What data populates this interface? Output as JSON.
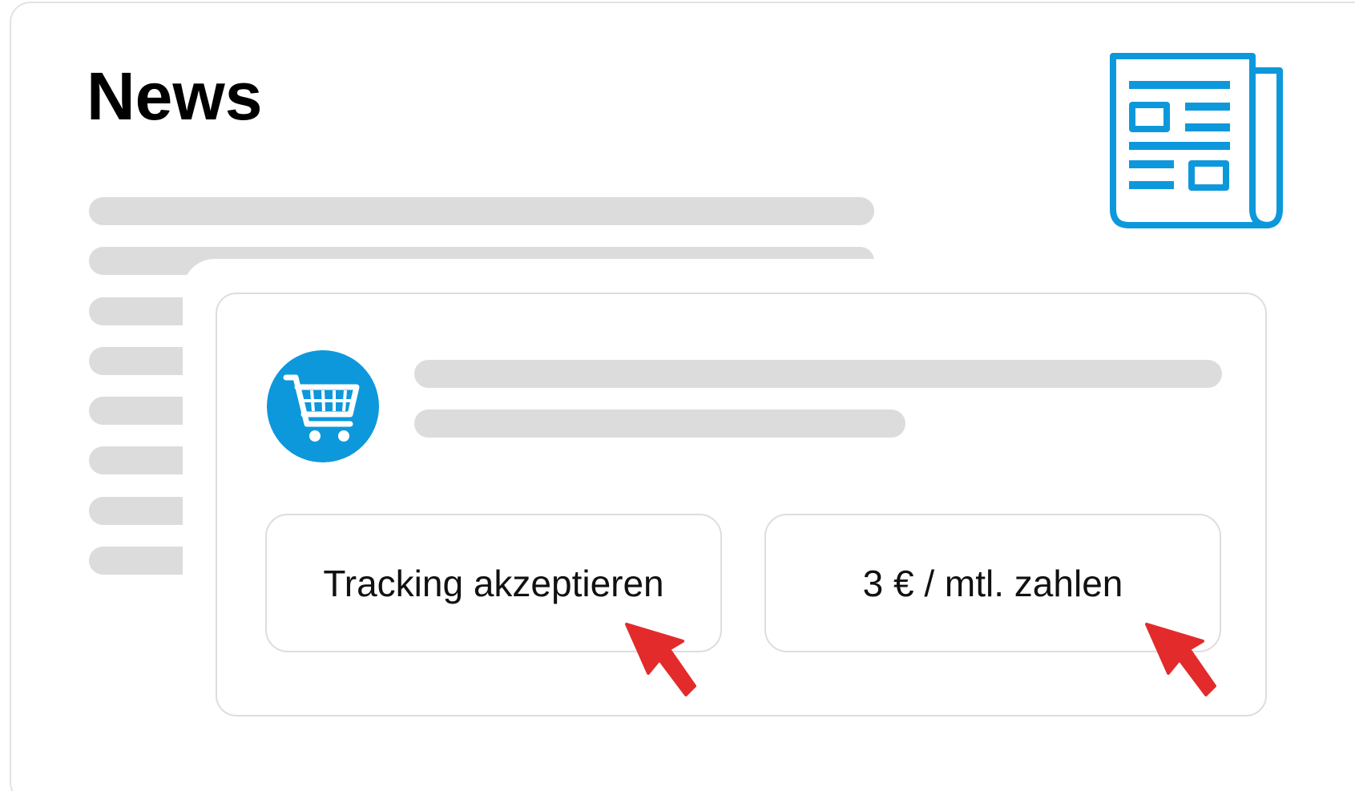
{
  "header": {
    "title": "News",
    "icon": "newspaper-icon"
  },
  "dialog": {
    "icon": "shopping-cart-icon",
    "buttons": [
      {
        "label": "Tracking akzeptieren",
        "cursor": "pointer-cursor-icon"
      },
      {
        "label": "3 € / mtl. zahlen",
        "cursor": "pointer-cursor-icon"
      }
    ]
  },
  "colors": {
    "accent_blue": "#0d98dc",
    "cursor_red": "#e32b2b",
    "placeholder_gray": "#dcdcdc",
    "border_gray": "#dddddd"
  }
}
